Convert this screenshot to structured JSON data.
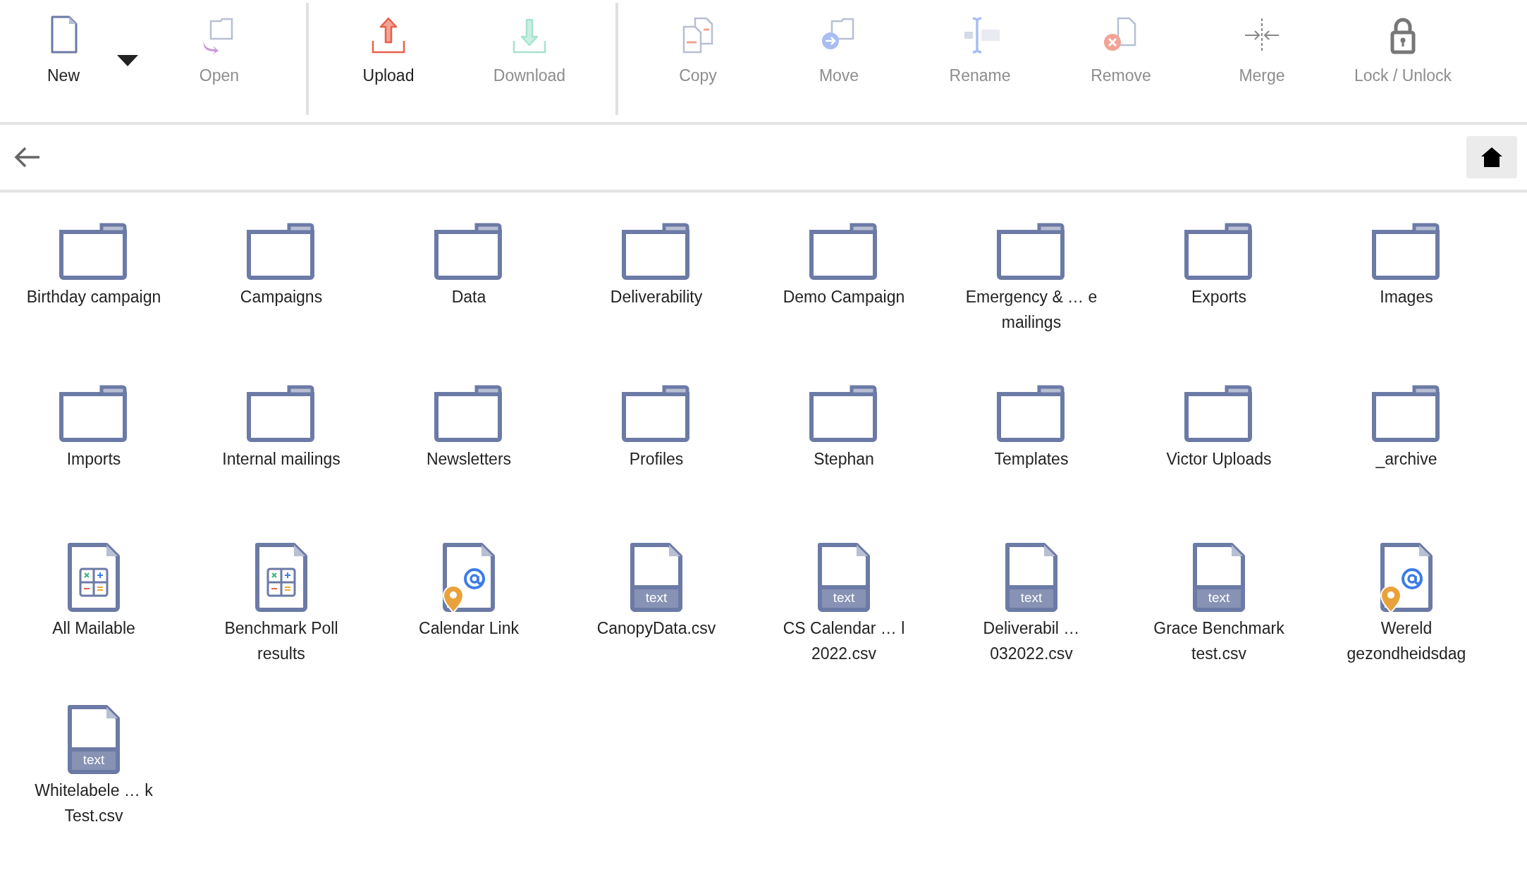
{
  "toolbar": {
    "groups": [
      [
        {
          "kind": "new",
          "label": "New",
          "disabled": false,
          "dropdown": true
        },
        {
          "kind": "open",
          "label": "Open",
          "disabled": true,
          "dropdown": false
        }
      ],
      [
        {
          "kind": "upload",
          "label": "Upload",
          "disabled": false,
          "dropdown": false
        },
        {
          "kind": "download",
          "label": "Download",
          "disabled": true,
          "dropdown": false
        }
      ],
      [
        {
          "kind": "copy",
          "label": "Copy",
          "disabled": true,
          "dropdown": false
        },
        {
          "kind": "move",
          "label": "Move",
          "disabled": true,
          "dropdown": false
        },
        {
          "kind": "rename",
          "label": "Rename",
          "disabled": true,
          "dropdown": false
        },
        {
          "kind": "remove",
          "label": "Remove",
          "disabled": true,
          "dropdown": false
        },
        {
          "kind": "merge",
          "label": "Merge",
          "disabled": true,
          "dropdown": false
        },
        {
          "kind": "lock",
          "label": "Lock / Unlock",
          "disabled": true,
          "dropdown": false
        }
      ]
    ]
  },
  "items": [
    {
      "kind": "folder",
      "lines": [
        "Birthday campaign"
      ]
    },
    {
      "kind": "folder",
      "lines": [
        "Campaigns"
      ]
    },
    {
      "kind": "folder",
      "lines": [
        "Data"
      ]
    },
    {
      "kind": "folder",
      "lines": [
        "Deliverability"
      ]
    },
    {
      "kind": "folder",
      "lines": [
        "Demo Campaign"
      ]
    },
    {
      "kind": "folder",
      "lines": [
        "Emergency & … e",
        "mailings"
      ]
    },
    {
      "kind": "folder",
      "lines": [
        "Exports"
      ]
    },
    {
      "kind": "folder",
      "lines": [
        "Images"
      ]
    },
    {
      "kind": "folder",
      "lines": [
        "Imports"
      ]
    },
    {
      "kind": "folder",
      "lines": [
        "Internal mailings"
      ]
    },
    {
      "kind": "folder",
      "lines": [
        "Newsletters"
      ]
    },
    {
      "kind": "folder",
      "lines": [
        "Profiles"
      ]
    },
    {
      "kind": "folder",
      "lines": [
        "Stephan"
      ]
    },
    {
      "kind": "folder",
      "lines": [
        "Templates"
      ]
    },
    {
      "kind": "folder",
      "lines": [
        "Victor Uploads"
      ]
    },
    {
      "kind": "folder",
      "lines": [
        "_archive"
      ]
    },
    {
      "kind": "sheet",
      "lines": [
        "All Mailable"
      ]
    },
    {
      "kind": "sheet",
      "lines": [
        "Benchmark Poll",
        "results"
      ]
    },
    {
      "kind": "mail",
      "lines": [
        "Calendar Link"
      ]
    },
    {
      "kind": "text",
      "badge": "text",
      "lines": [
        "CanopyData.csv"
      ]
    },
    {
      "kind": "text",
      "badge": "text",
      "lines": [
        "CS Calendar … l",
        "2022.csv"
      ]
    },
    {
      "kind": "text",
      "badge": "text",
      "lines": [
        "Deliverabil …",
        "032022.csv"
      ]
    },
    {
      "kind": "text",
      "badge": "text",
      "lines": [
        "Grace Benchmark",
        "test.csv"
      ]
    },
    {
      "kind": "mail",
      "lines": [
        "Wereld",
        "gezondheidsdag"
      ]
    },
    {
      "kind": "text",
      "badge": "text",
      "lines": [
        "Whitelabele … k",
        "Test.csv"
      ]
    }
  ]
}
